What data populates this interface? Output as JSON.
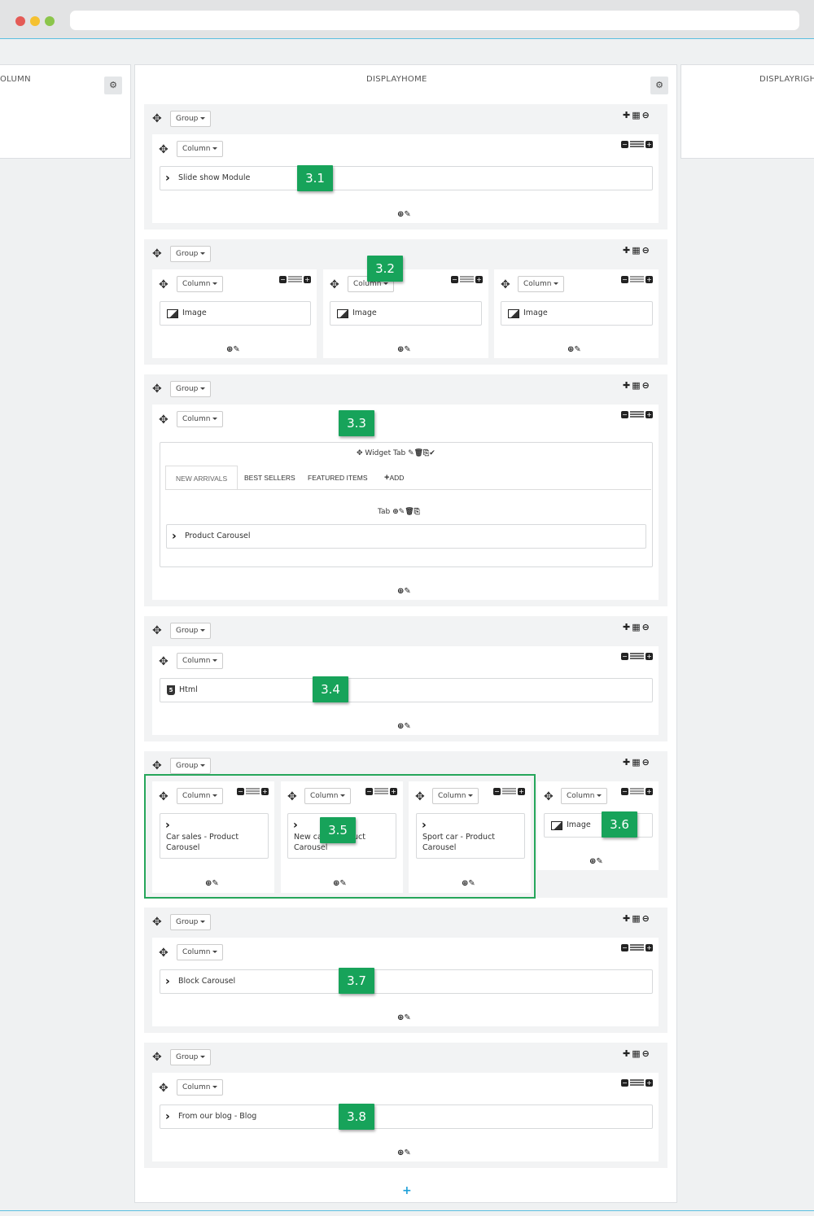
{
  "hooks": {
    "left_title": "OLUMN",
    "center_title": "DISPLAYHOME",
    "right_title": "DISPLAYRIGHT",
    "add_plus": "+"
  },
  "labels": {
    "group": "Group",
    "column": "Column",
    "image": "Image"
  },
  "groups": [
    {
      "badge": "3.1",
      "module": "Slide show Module"
    },
    {
      "badge": "3.2"
    },
    {
      "badge": "3.3",
      "widget_tab": "Widget Tab",
      "tabs": [
        "NEW ARRIVALS",
        "BEST SELLERS",
        "FEATURED ITEMS",
        "ADD"
      ],
      "tab_label": "Tab",
      "module": "Product Carousel"
    },
    {
      "badge": "3.4",
      "module": "Html"
    },
    {
      "badge": "3.5",
      "modules": [
        "Car sales - Product Carousel",
        "New ca      uct Carousel",
        "Sport car - Product Carousel"
      ],
      "lines": [
        [
          "Car sales - Product",
          "Carousel"
        ],
        [
          "New ca",
          "uct",
          "Carousel"
        ],
        [
          "Sport car - Product",
          "Carousel"
        ]
      ],
      "badge2": "3.6"
    },
    {
      "badge": "3.7",
      "module": "Block Carousel"
    },
    {
      "badge": "3.8",
      "module": "From our blog - Blog"
    }
  ],
  "colors": {
    "badge": "#17a35a",
    "accent": "#1ea0d8"
  }
}
